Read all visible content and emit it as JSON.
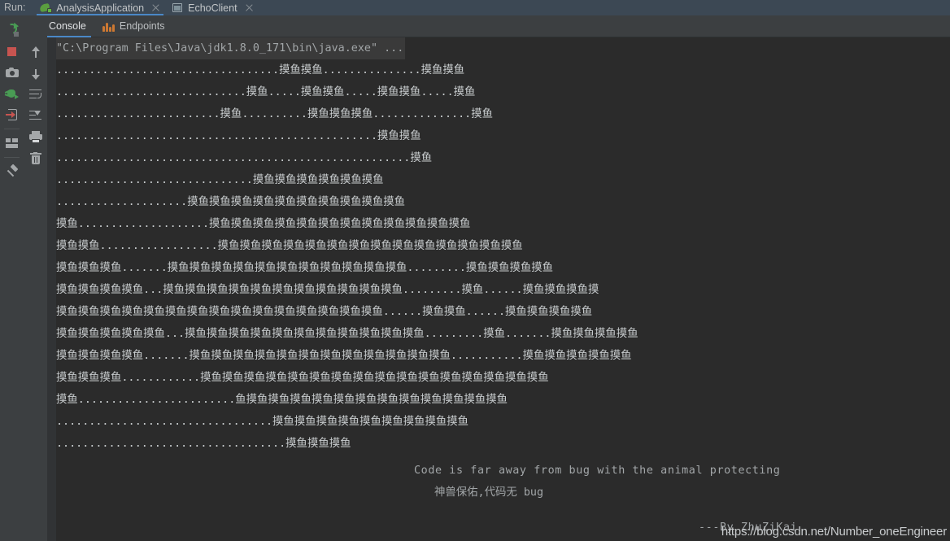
{
  "window": {
    "run_label": "Run:",
    "tabs": [
      {
        "label": "AnalysisApplication",
        "icon": "spring-boot-icon",
        "active": true,
        "closable": true
      },
      {
        "label": "EchoClient",
        "icon": "window-icon",
        "active": false,
        "closable": true
      }
    ]
  },
  "subtabs": [
    {
      "label": "Console",
      "icon": "console-icon",
      "active": true
    },
    {
      "label": "Endpoints",
      "icon": "endpoints-icon",
      "active": false
    }
  ],
  "left_toolbar_primary": [
    {
      "name": "rerun-button",
      "icon": "rerun-icon",
      "tooltip": "Rerun"
    },
    {
      "name": "stop-button",
      "icon": "stop-icon",
      "tooltip": "Stop"
    },
    {
      "name": "screenshot-button",
      "icon": "camera-icon",
      "tooltip": "Screenshot"
    },
    {
      "name": "debug-button",
      "icon": "bug-icon",
      "tooltip": "Debug"
    },
    {
      "name": "attach-button",
      "icon": "enter-arrow-icon",
      "tooltip": "Attach"
    },
    {
      "name": "layout-button",
      "icon": "layout-icon",
      "tooltip": "Layout Settings"
    },
    {
      "name": "pin-button",
      "icon": "pin-icon",
      "tooltip": "Pin Tab"
    }
  ],
  "left_toolbar_secondary": [
    {
      "name": "up-button",
      "icon": "arrow-up-icon",
      "tooltip": "Up the Stack Trace"
    },
    {
      "name": "down-button",
      "icon": "arrow-down-icon",
      "tooltip": "Down the Stack Trace"
    },
    {
      "name": "soft-wrap-button",
      "icon": "soft-wrap-icon",
      "tooltip": "Use Soft Wraps"
    },
    {
      "name": "scroll-to-end-button",
      "icon": "scroll-to-end-icon",
      "tooltip": "Scroll to the End"
    },
    {
      "name": "print-button",
      "icon": "print-icon",
      "tooltip": "Print"
    },
    {
      "name": "clear-button",
      "icon": "trash-icon",
      "tooltip": "Clear All"
    }
  ],
  "console": {
    "command_line": "\"C:\\Program Files\\Java\\jdk1.8.0_171\\bin\\java.exe\" ...",
    "art_lines": [
      "..................................摸鱼摸鱼...............摸鱼摸鱼",
      ".............................摸鱼.....摸鱼摸鱼.....摸鱼摸鱼.....摸鱼",
      ".........................摸鱼..........摸鱼摸鱼摸鱼...............摸鱼",
      ".................................................摸鱼摸鱼",
      "......................................................摸鱼",
      "..............................摸鱼摸鱼摸鱼摸鱼摸鱼摸鱼",
      "....................摸鱼摸鱼摸鱼摸鱼摸鱼摸鱼摸鱼摸鱼摸鱼摸鱼",
      "摸鱼....................摸鱼摸鱼摸鱼摸鱼摸鱼摸鱼摸鱼摸鱼摸鱼摸鱼摸鱼摸鱼",
      "摸鱼摸鱼..................摸鱼摸鱼摸鱼摸鱼摸鱼摸鱼摸鱼摸鱼摸鱼摸鱼摸鱼摸鱼摸鱼摸鱼",
      "摸鱼摸鱼摸鱼.......摸鱼摸鱼摸鱼摸鱼摸鱼摸鱼摸鱼摸鱼摸鱼摸鱼摸鱼.........摸鱼摸鱼摸鱼摸鱼",
      "摸鱼摸鱼摸鱼摸鱼...摸鱼摸鱼摸鱼摸鱼摸鱼摸鱼摸鱼摸鱼摸鱼摸鱼摸鱼.........摸鱼......摸鱼摸鱼摸鱼摸",
      "摸鱼摸鱼摸鱼摸鱼摸鱼摸鱼摸鱼摸鱼摸鱼摸鱼摸鱼摸鱼摸鱼摸鱼摸鱼......摸鱼摸鱼......摸鱼摸鱼摸鱼摸鱼",
      "摸鱼摸鱼摸鱼摸鱼摸鱼...摸鱼摸鱼摸鱼摸鱼摸鱼摸鱼摸鱼摸鱼摸鱼摸鱼摸鱼.........摸鱼.......摸鱼摸鱼摸鱼摸鱼",
      "摸鱼摸鱼摸鱼摸鱼.......摸鱼摸鱼摸鱼摸鱼摸鱼摸鱼摸鱼摸鱼摸鱼摸鱼摸鱼摸鱼...........摸鱼摸鱼摸鱼摸鱼摸鱼",
      "摸鱼摸鱼摸鱼............摸鱼摸鱼摸鱼摸鱼摸鱼摸鱼摸鱼摸鱼摸鱼摸鱼摸鱼摸鱼摸鱼摸鱼摸鱼摸鱼",
      "摸鱼........................鱼摸鱼摸鱼摸鱼摸鱼摸鱼摸鱼摸鱼摸鱼摸鱼摸鱼摸鱼摸鱼",
      ".................................摸鱼摸鱼摸鱼摸鱼摸鱼摸鱼摸鱼摸鱼摸鱼",
      "...................................摸鱼摸鱼摸鱼"
    ],
    "message_en": "Code is far away from bug with the animal protecting",
    "message_cn": "神兽保佑,代码无 bug",
    "signature": "---By ZhuZiKai"
  },
  "watermark": "https://blog.csdn.net/Number_oneEngineer",
  "colors": {
    "tabbar_bg": "#3c4854",
    "toolbar_bg": "#3c3f41",
    "console_bg": "#2b2b2b",
    "accent_blue": "#4a88c7",
    "text_primary": "#c8ccce",
    "run_green": "#499c54",
    "stop_red": "#c75450",
    "endpoint_orange": "#cc7832"
  }
}
